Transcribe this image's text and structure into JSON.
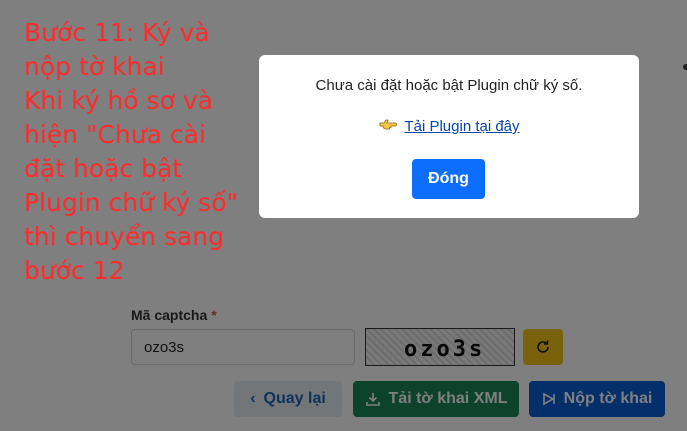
{
  "instruction": {
    "text": "Bước 11: Ký và nộp tờ khai\nKhi ký hồ sơ và hiện \"Chưa cài đặt hoặc bật Plugin chữ ký số\" thì chuyển sang bước 12"
  },
  "form": {
    "captcha_label": "Mã captcha",
    "required_mark": "*",
    "captcha_value": "ozo3s",
    "captcha_image_text": "ozo3s"
  },
  "buttons": {
    "back": "Quay lại",
    "xml": "Tải tờ khai XML",
    "submit": "Nộp tờ khai"
  },
  "modal": {
    "message": "Chưa cài đặt hoặc bật Plugin chữ ký số.",
    "link": "Tải Plugin tại đây",
    "close": "Đóng"
  },
  "colors": {
    "instruction": "#ff2a2a",
    "primary": "#0d6efd",
    "success": "#198754",
    "warning": "#f5c518"
  },
  "icons": {
    "back": "chevron-left-icon",
    "xml": "download-icon",
    "submit": "send-icon",
    "refresh": "refresh-icon",
    "link": "pointing-hand-icon"
  }
}
